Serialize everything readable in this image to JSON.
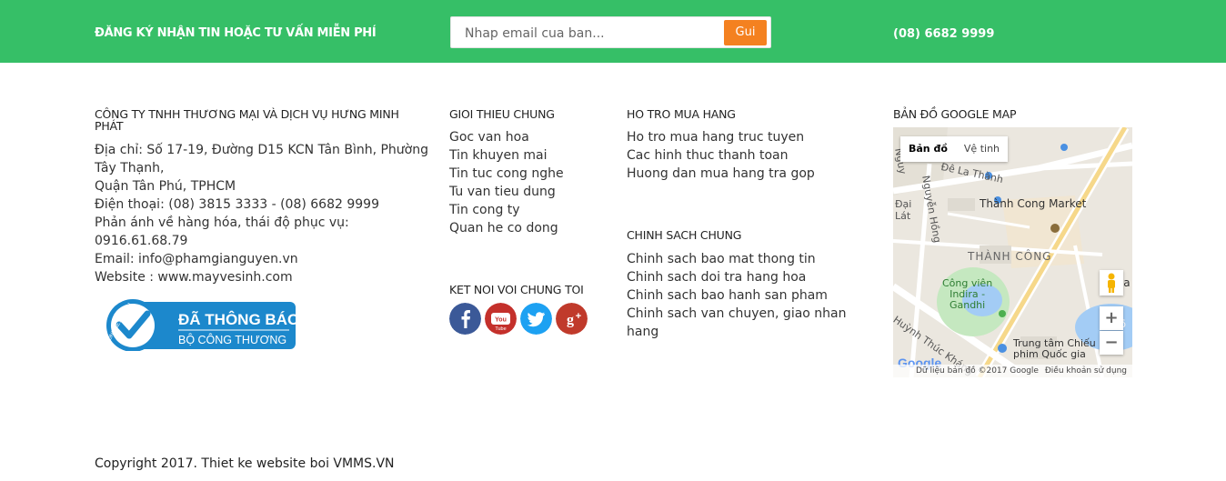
{
  "signup_bar": {
    "title": "ĐĂNG KÝ NHẬN TIN HOẶC TƯ VẤN MIỄN PHÍ",
    "email_placeholder": "Nhap email cua ban...",
    "submit_label": "Gui",
    "phone": "(08) 6682 9999"
  },
  "company": {
    "name": "CÔNG TY TNHH THƯƠNG MẠI VÀ DỊCH VỤ HƯNG MINH PHÁT",
    "address_line1": "Địa chỉ: Số 17-19, Đường D15 KCN Tân Bình, Phường",
    "address_line2": "Tây Thạnh,",
    "address_line3": "Quận Tân Phú, TPHCM",
    "phone": "Điện thoại: (08) 3815 3333 - (08) 6682 9999",
    "feedback_label": "Phản ánh về hàng hóa, thái độ phục vụ:",
    "feedback_phone": "0916.61.68.79",
    "email": "Email: info@phamgianguyen.vn",
    "website": "Website : www.mayvesinh.com",
    "badge": {
      "line1": "ĐÃ THÔNG BÁO",
      "line2": "BỘ CÔNG THƯƠNG",
      "seal_text": "ONLINE.GOV.VN"
    }
  },
  "intro": {
    "heading": "GIOI THIEU CHUNG",
    "links": [
      "Goc van hoa",
      "Tin khuyen mai",
      "Tin tuc cong nghe",
      "Tu van tieu dung",
      "Tin cong ty",
      "Quan he co dong"
    ]
  },
  "connect": {
    "heading": "KET NOI VOI CHUNG TOI",
    "icons": [
      {
        "name": "facebook-icon",
        "color": "#3b5998"
      },
      {
        "name": "youtube-icon",
        "color": "#c4302b"
      },
      {
        "name": "twitter-icon",
        "color": "#1da1f2"
      },
      {
        "name": "google-plus-icon",
        "color": "#c03a2b"
      }
    ]
  },
  "support": {
    "heading": "HO TRO MUA HANG",
    "links": [
      "Ho tro mua hang truc tuyen",
      "Cac hinh thuc thanh toan",
      "Huong dan mua hang tra gop"
    ]
  },
  "policy": {
    "heading": "CHINH SACH CHUNG",
    "links": [
      "Chinh sach bao mat thong tin",
      "Chinh sach doi tra hang hoa",
      "Chinh sach bao hanh san pham",
      "Chinh sach van chuyen, giao nhan hang"
    ]
  },
  "map": {
    "heading": "BẢN ĐỒ GOOGLE MAP",
    "tab_map": "Bản đồ",
    "tab_satellite": "Vệ tinh",
    "zoom_in": "+",
    "zoom_out": "−",
    "labels": {
      "de_la_thanh": "Đê La Thành",
      "thanh_cong_market": "Thành Cong Market",
      "thanh_cong": "THÀNH CÔNG",
      "park": "Công viên\nIndira -\nGandhi",
      "dai_lat": "Đại\nLát",
      "ba": "Ba",
      "huynh_thuc_khang": "Huỳnh Thúc Kháng",
      "nguyen_hong": "Nguyễn Hồng",
      "nguy": "Nguy",
      "cinema": "Trung tâm Chiếu\nphim Quốc gia",
      "ho": "Hồ"
    },
    "google": "Google",
    "attribution": "Dữ liệu bản đồ ©2017 Google",
    "terms": "Điều khoản sử dụng"
  },
  "copyright": "Copyright 2017. Thiet ke website boi VMMS.VN"
}
